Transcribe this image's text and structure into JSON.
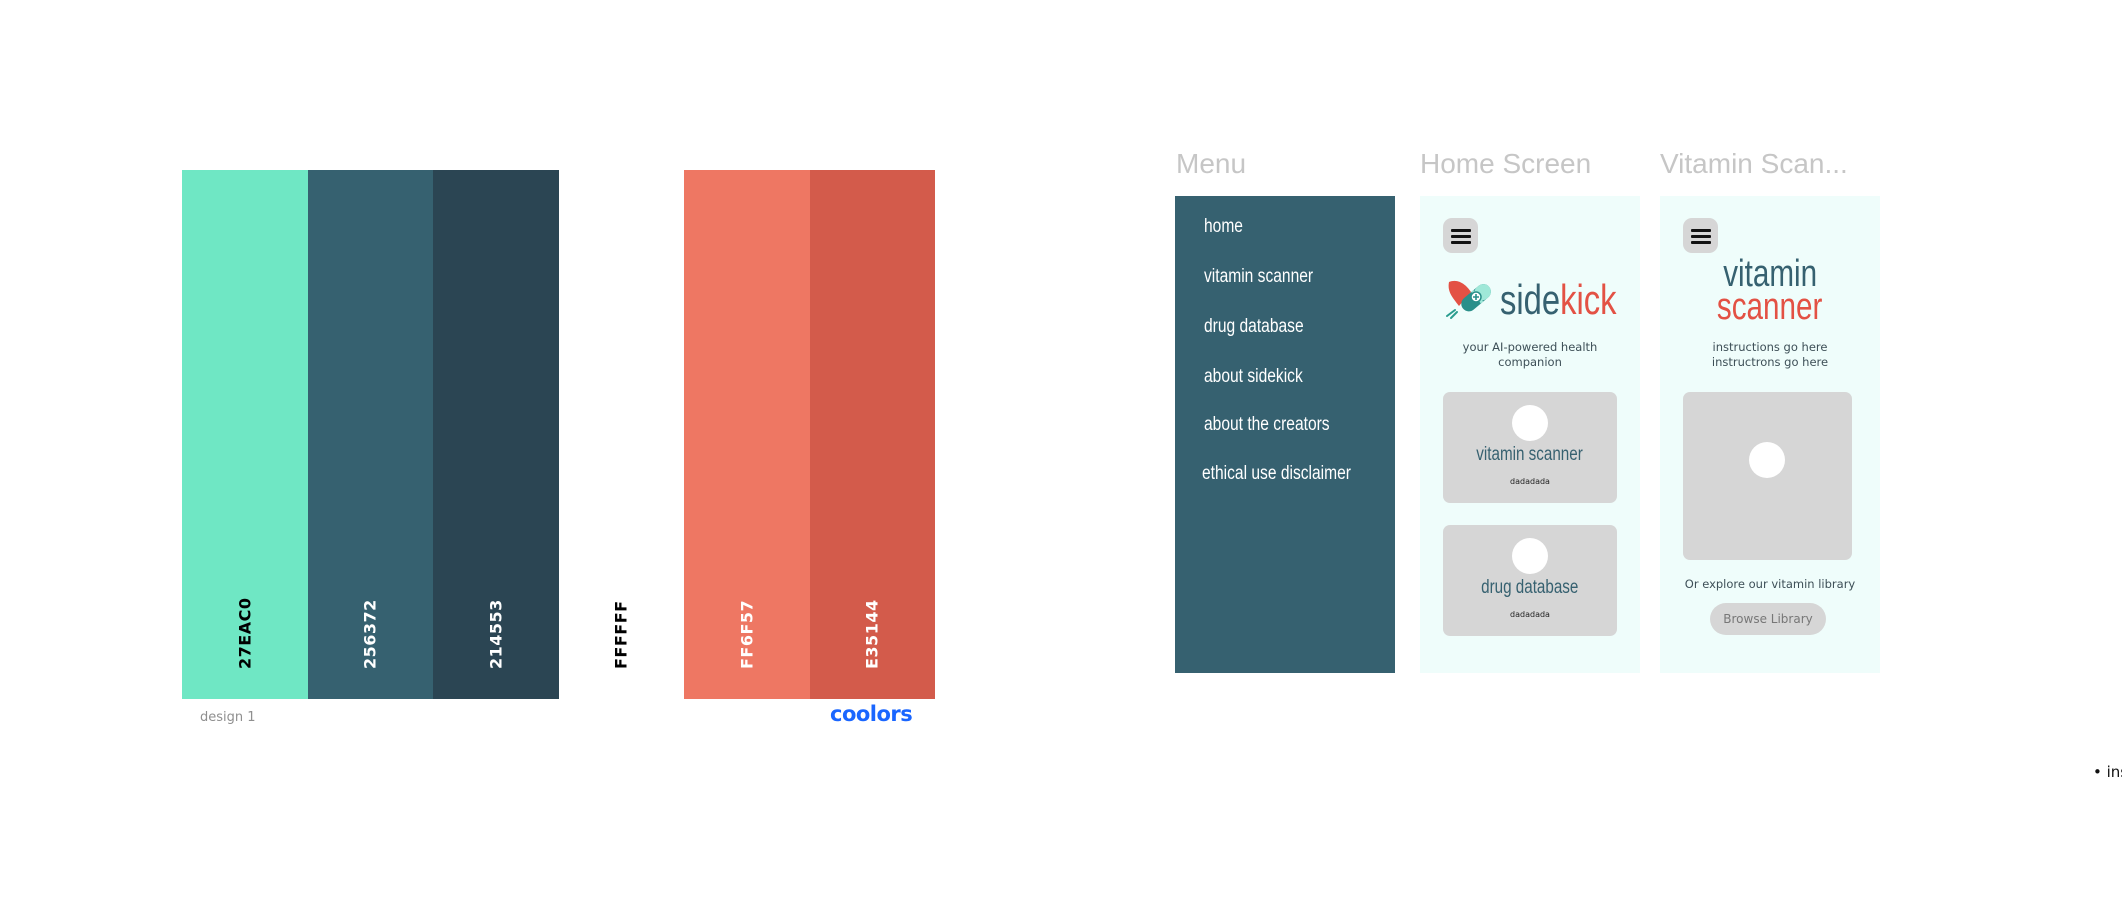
{
  "palette": {
    "name": "design 1",
    "brand": "coolors",
    "swatches": [
      {
        "hex": "27EAC0",
        "color": "#6fe7c4",
        "text_color": "#000000"
      },
      {
        "hex": "256372",
        "color": "#366170",
        "text_color": "#ffffff"
      },
      {
        "hex": "214553",
        "color": "#2b4553",
        "text_color": "#ffffff"
      },
      {
        "hex": "FFFFFF",
        "color": "#ffffff",
        "text_color": "#000000"
      },
      {
        "hex": "FF6F57",
        "color": "#ee7763",
        "text_color": "#ffffff"
      },
      {
        "hex": "E35144",
        "color": "#d35b4b",
        "text_color": "#ffffff"
      }
    ]
  },
  "menu_frame": {
    "title": "Menu",
    "items": [
      "home",
      "vitamin scanner",
      "drug database",
      "about sidekick",
      "about the creators",
      "ethical use disclaimer"
    ]
  },
  "home_frame": {
    "title": "Home Screen",
    "logo_part1": "side",
    "logo_part2": "kick",
    "tagline_line1": "your AI-powered health",
    "tagline_line2": "companion",
    "cards": [
      {
        "title": "vitamin scanner",
        "subtitle": "dadadada"
      },
      {
        "title": "drug database",
        "subtitle": "dadadada"
      }
    ]
  },
  "vitamin_frame": {
    "title": "Vitamin Scan...",
    "heading_line1": "vitamin",
    "heading_line2": "scanner",
    "instructions_line1": "instructions go here",
    "instructions_line2": "instructrons go here",
    "explore_text": "Or explore our vitamin library",
    "browse_button": "Browse Library"
  },
  "bullet_fragment": "ins",
  "colors": {
    "teal_dark": "#366170",
    "coral": "#e35144",
    "card_gray": "#d6d6d6",
    "frame_bg": "#effdfb",
    "title_gray": "#c6c6c6",
    "coolors_blue": "#1a66ff"
  }
}
